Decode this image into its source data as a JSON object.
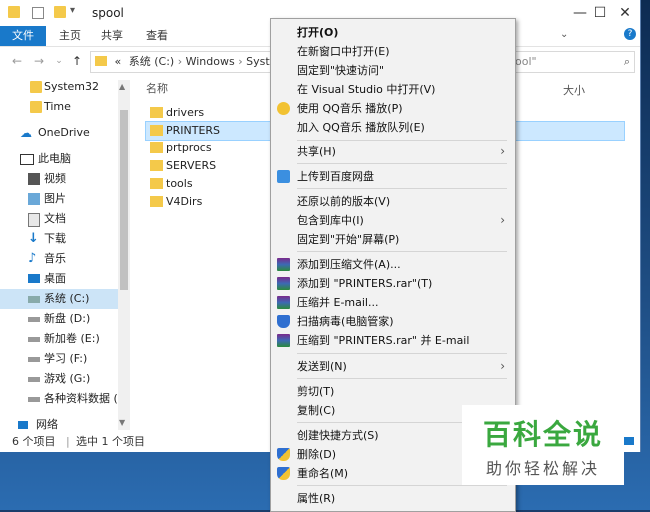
{
  "window": {
    "title": "spool",
    "minimize": "—",
    "maximize": "☐",
    "close": "✕"
  },
  "ribbon": {
    "tabs": [
      "文件",
      "主页",
      "共享",
      "查看"
    ],
    "help": "?"
  },
  "address": {
    "path_prefix": "«",
    "segments": [
      "系统 (C:)",
      "Windows",
      "Syst"
    ],
    "search_text": "pool\""
  },
  "columns": {
    "size": "大小"
  },
  "navpane": {
    "items": [
      {
        "label": "System32",
        "icon": "folder-icon"
      },
      {
        "label": "Time",
        "icon": "folder-icon"
      },
      {
        "label": "OneDrive",
        "icon": "cloud-icon"
      },
      {
        "label": "此电脑",
        "icon": "computer-icon"
      },
      {
        "label": "视频",
        "icon": "video-icon"
      },
      {
        "label": "图片",
        "icon": "picture-icon"
      },
      {
        "label": "文档",
        "icon": "document-icon"
      },
      {
        "label": "下载",
        "icon": "download-icon"
      },
      {
        "label": "音乐",
        "icon": "music-icon"
      },
      {
        "label": "桌面",
        "icon": "desktop-icon"
      },
      {
        "label": "系统 (C:)",
        "icon": "drive-icon"
      },
      {
        "label": "新盘 (D:)",
        "icon": "drive-icon"
      },
      {
        "label": "新加卷 (E:)",
        "icon": "drive-icon"
      },
      {
        "label": "学习 (F:)",
        "icon": "drive-icon"
      },
      {
        "label": "游戏 (G:)",
        "icon": "drive-icon"
      },
      {
        "label": "各种资料数据 (H",
        "icon": "drive-icon"
      },
      {
        "label": "网络",
        "icon": "network-icon"
      }
    ]
  },
  "files": [
    {
      "name": "drivers"
    },
    {
      "name": "PRINTERS"
    },
    {
      "name": "prtprocs"
    },
    {
      "name": "SERVERS"
    },
    {
      "name": "tools"
    },
    {
      "name": "V4Dirs"
    }
  ],
  "status": {
    "count": "6 个项目",
    "selected": "选中 1 个项目"
  },
  "context_menu": {
    "items": [
      {
        "label": "打开(O)",
        "bold": true
      },
      {
        "label": "在新窗口中打开(E)"
      },
      {
        "label": "固定到\"快速访问\""
      },
      {
        "label": "在 Visual Studio 中打开(V)"
      },
      {
        "label": "使用 QQ音乐 播放(P)",
        "icon": "qq-music-icon"
      },
      {
        "label": "加入 QQ音乐 播放队列(E)"
      },
      {
        "label": "共享(H)",
        "submenu": true
      },
      {
        "label": "上传到百度网盘",
        "icon": "baidu-cloud-icon"
      },
      {
        "label": "还原以前的版本(V)"
      },
      {
        "label": "包含到库中(I)",
        "submenu": true
      },
      {
        "label": "固定到\"开始\"屏幕(P)"
      },
      {
        "label": "添加到压缩文件(A)...",
        "icon": "winrar-icon"
      },
      {
        "label": "添加到 \"PRINTERS.rar\"(T)",
        "icon": "winrar-icon"
      },
      {
        "label": "压缩并 E-mail...",
        "icon": "winrar-icon"
      },
      {
        "label": "扫描病毒(电脑管家)",
        "icon": "shield-scan-icon"
      },
      {
        "label": "压缩到 \"PRINTERS.rar\" 并 E-mail",
        "icon": "winrar-icon"
      },
      {
        "label": "发送到(N)",
        "submenu": true
      },
      {
        "label": "剪切(T)"
      },
      {
        "label": "复制(C)"
      },
      {
        "label": "创建快捷方式(S)"
      },
      {
        "label": "删除(D)",
        "icon": "uac-shield-icon"
      },
      {
        "label": "重命名(M)",
        "icon": "uac-shield-icon"
      },
      {
        "label": "属性(R)"
      }
    ]
  },
  "watermark": {
    "main": "百科全说",
    "sub": "助你轻松解决"
  }
}
